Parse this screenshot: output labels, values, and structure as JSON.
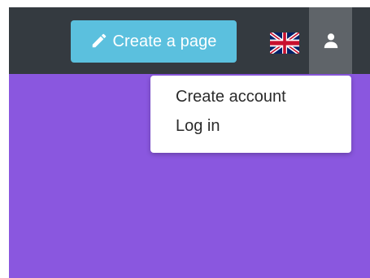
{
  "header": {
    "create_page_label": "Create a page",
    "language_icon": "uk-flag-icon",
    "user_icon": "user-icon"
  },
  "user_menu": {
    "items": [
      {
        "label": "Create account"
      },
      {
        "label": "Log in"
      }
    ]
  },
  "colors": {
    "topbar": "#343a40",
    "create_button": "#5bc0de",
    "user_button_active": "#5f6469",
    "content_background": "#8a57df",
    "dropdown_background": "#ffffff",
    "dropdown_text": "#2b2b2b"
  }
}
